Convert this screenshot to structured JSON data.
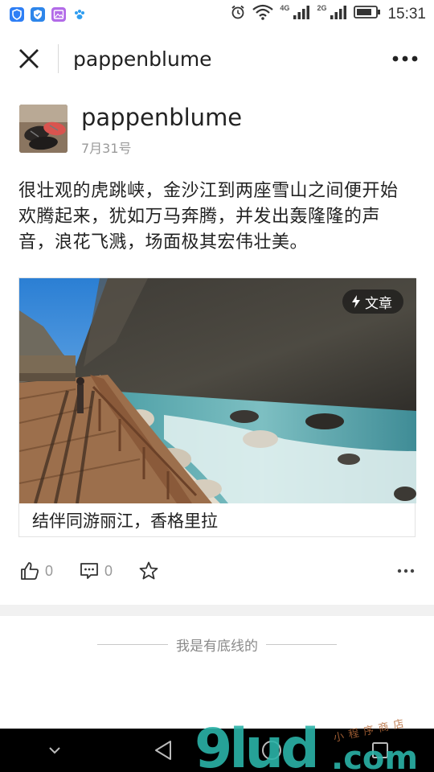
{
  "status_bar": {
    "network_1": "4G",
    "network_2": "2G",
    "time": "15:31",
    "app_icon_colors": [
      "#2f7ff5",
      "#2e86ea",
      "#b26be8",
      "#2f9df0"
    ]
  },
  "nav": {
    "title": "pappenblume"
  },
  "author": {
    "name": "pappenblume",
    "date": "7月31号"
  },
  "post": {
    "text": "很壮观的虎跳峡，金沙江到两座雪山之间便开始欢腾起来，犹如万马奔腾，并发出轰隆隆的声音，浪花飞溅，场面极其宏伟壮美。"
  },
  "card": {
    "badge_label": "文章",
    "caption": "结伴同游丽江，香格里拉"
  },
  "actions": {
    "like_count": "0",
    "comment_count": "0"
  },
  "footer": {
    "bottom_text": "我是有底线的"
  },
  "watermark": {
    "brand": "9ludcom",
    "sub": "小程序商店"
  },
  "colors": {
    "text": "#222222",
    "muted": "#999999",
    "separator": "#f1f1f1",
    "sysnav": "#000000"
  }
}
